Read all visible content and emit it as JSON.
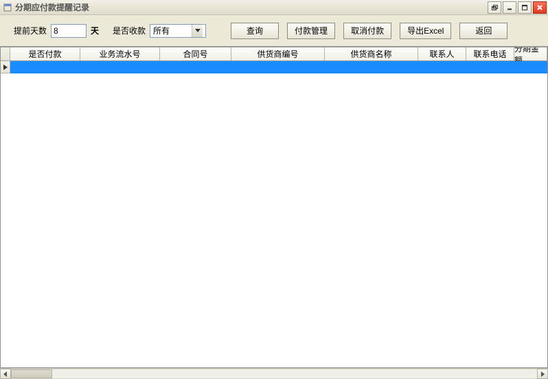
{
  "window": {
    "title": "分期应付款提醒记录"
  },
  "toolbar": {
    "advance_days_label": "提前天数",
    "advance_days_value": "8",
    "days_unit": "天",
    "is_received_label": "是否收款",
    "is_received_value": "所有",
    "buttons": {
      "query": "查询",
      "payment_mgmt": "付款管理",
      "cancel_payment": "取消付款",
      "export_excel": "导出Excel",
      "back": "返回"
    }
  },
  "grid": {
    "columns": [
      {
        "key": "is_paid",
        "label": "是否付款",
        "width": 102
      },
      {
        "key": "serial_no",
        "label": "业务流水号",
        "width": 116
      },
      {
        "key": "contract_no",
        "label": "合同号",
        "width": 104
      },
      {
        "key": "supplier_code",
        "label": "供货商编号",
        "width": 136
      },
      {
        "key": "supplier_name",
        "label": "供货商名称",
        "width": 136
      },
      {
        "key": "contact",
        "label": "联系人",
        "width": 70
      },
      {
        "key": "phone",
        "label": "联系电话",
        "width": 70
      },
      {
        "key": "installment",
        "label": "分期金额",
        "width": 48
      }
    ],
    "rows": [
      {
        "selected": true
      }
    ]
  }
}
